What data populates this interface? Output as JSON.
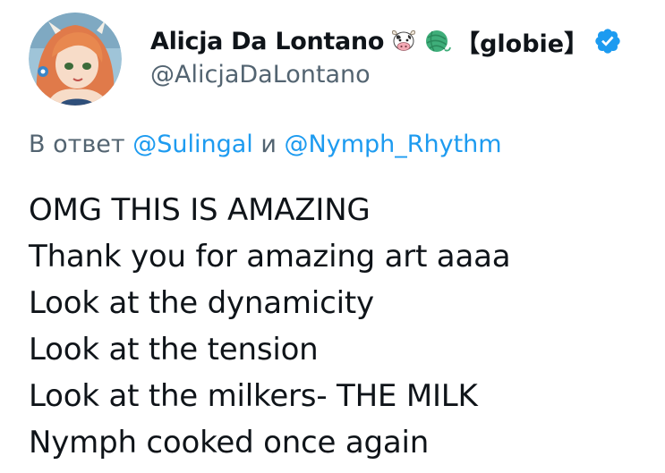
{
  "author": {
    "display_name": "Alicja Da Lontano",
    "name_emojis": [
      "cow-face-icon",
      "yarn-ball-icon"
    ],
    "name_suffix": "【globie】",
    "verified": true,
    "handle": "@AlicjaDaLontano",
    "avatar": "avatar-image"
  },
  "reply": {
    "prefix": "В ответ",
    "mention1": "@Sulingal",
    "connector": "и",
    "mention2": "@Nymph_Rhythm"
  },
  "tweet": {
    "lines": [
      "OMG THIS IS AMAZING",
      "Thank you for amazing art aaaa",
      "Look at the dynamicity",
      "Look at the tension",
      "Look at the milkers- THE MILK",
      "Nymph cooked once again"
    ]
  },
  "colors": {
    "text": "#0f1419",
    "secondary": "#536471",
    "link": "#1d9bf0",
    "verified": "#1d9bf0"
  }
}
